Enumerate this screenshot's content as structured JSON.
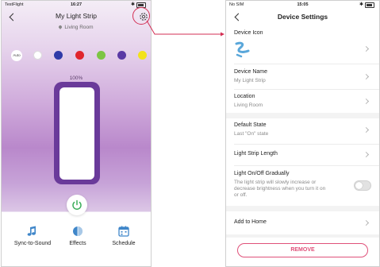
{
  "left_screen": {
    "status": {
      "carrier": "TestFlight",
      "time": "16:27"
    },
    "title": "My Light Strip",
    "room": "Living Room",
    "auto_label": "Auto",
    "swatch_colors": [
      "#ffffff",
      "#2f3aa8",
      "#e0262d",
      "#7cc544",
      "#5a3aa5",
      "#f2e21b"
    ],
    "brightness_label": "100%",
    "brightness_fraction": 1.0,
    "tabs": [
      {
        "label": "Sync-to-Sound",
        "icon": "music-note-icon"
      },
      {
        "label": "Effects",
        "icon": "effects-icon"
      },
      {
        "label": "Schedule",
        "icon": "calendar-icon"
      }
    ],
    "accent": "#3f86c9",
    "power_color": "#3cae5b",
    "strip_frame_color": "#6a3a9a"
  },
  "right_screen": {
    "status": {
      "carrier": "No SIM",
      "time": "15:05"
    },
    "title": "Device Settings",
    "device_icon_label": "Device Icon",
    "device_icon": "light-strip-icon",
    "device_name_label": "Device Name",
    "device_name_value": "My Light Strip",
    "location_label": "Location",
    "location_value": "Living Room",
    "default_state_label": "Default State",
    "default_state_value": "Last \"On\" state",
    "strip_length_label": "Light Strip Length",
    "gradual_label": "Light On/Off Gradually",
    "gradual_desc_1": "The light strip will slowly increase or",
    "gradual_desc_2": "decrease brightness when you turn it on",
    "gradual_desc_3": "or off.",
    "gradual_enabled": false,
    "add_home_label": "Add to Home",
    "remove_label": "REMOVE",
    "remove_color": "#e0517a"
  },
  "annotation": {
    "highlight_color": "#d32f54"
  }
}
